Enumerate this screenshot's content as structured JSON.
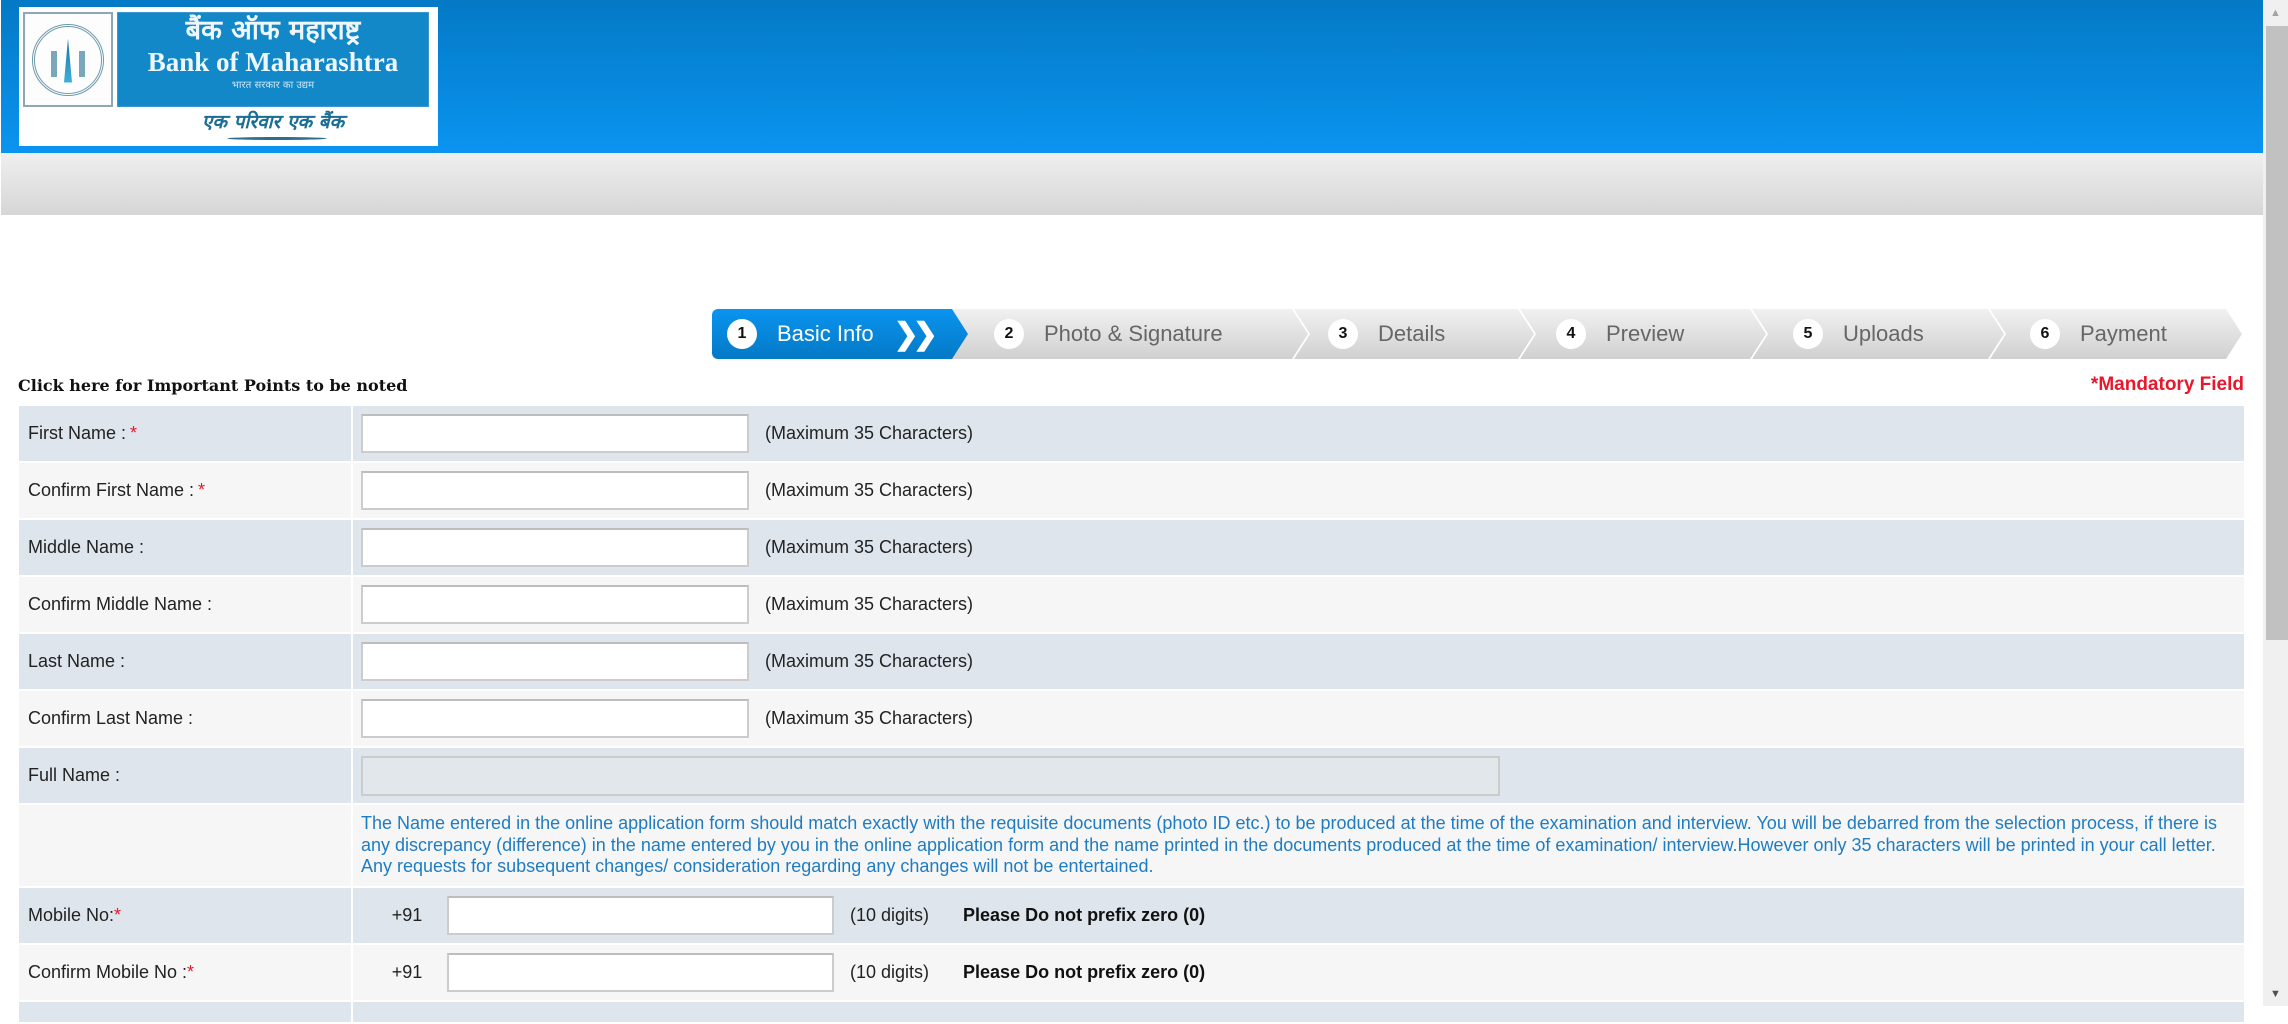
{
  "header": {
    "logo": {
      "hindi_name": "बैंक ऑफ महाराष्ट्र",
      "english_name": "Bank of Maharashtra",
      "sub_text": "भारत सरकार का उद्यम",
      "tagline": "एक परिवार एक बैंक"
    },
    "brand_color": "#0a94f0"
  },
  "stepper": {
    "steps": [
      {
        "number": "1",
        "label": "Basic Info",
        "active": true
      },
      {
        "number": "2",
        "label": "Photo & Signature",
        "active": false
      },
      {
        "number": "3",
        "label": "Details",
        "active": false
      },
      {
        "number": "4",
        "label": "Preview",
        "active": false
      },
      {
        "number": "5",
        "label": "Uploads",
        "active": false
      },
      {
        "number": "6",
        "label": "Payment",
        "active": false
      }
    ],
    "active_chevron": "❯❯"
  },
  "important_points_link": "Click here for Important Points to be noted",
  "mandatory_note": "*Mandatory Field",
  "form": {
    "required_mark": "*",
    "max_hint": "(Maximum 35 Characters)",
    "fields": [
      {
        "label": "First Name :",
        "required": true,
        "value": ""
      },
      {
        "label": "Confirm First Name :",
        "required": true,
        "value": ""
      },
      {
        "label": "Middle Name :",
        "required": false,
        "value": ""
      },
      {
        "label": "Confirm Middle Name :",
        "required": false,
        "value": ""
      },
      {
        "label": "Last Name :",
        "required": false,
        "value": ""
      },
      {
        "label": "Confirm Last Name :",
        "required": false,
        "value": ""
      }
    ],
    "full_name": {
      "label": "Full Name :",
      "value": ""
    },
    "notice": "The Name entered in the online application form should match exactly with the requisite documents (photo ID etc.) to be produced at the time of the examination and interview. You will be debarred from the selection process, if there is any discrepancy (difference) in the name entered by you in the online application form and the name printed in the documents produced at the time of examination/ interview.However only 35 characters will be printed in your call letter. Any requests for subsequent changes/ consideration regarding any changes will not be entertained.",
    "mobile": {
      "label": "Mobile No:",
      "confirm_label": "Confirm Mobile No :",
      "country_code": "+91",
      "digits_hint": "(10 digits)",
      "no_zero_hint": "Please Do not prefix zero (0)",
      "value": "",
      "confirm_value": ""
    }
  },
  "scrollbar": {
    "up_icon": "▲",
    "down_icon": "▼"
  }
}
